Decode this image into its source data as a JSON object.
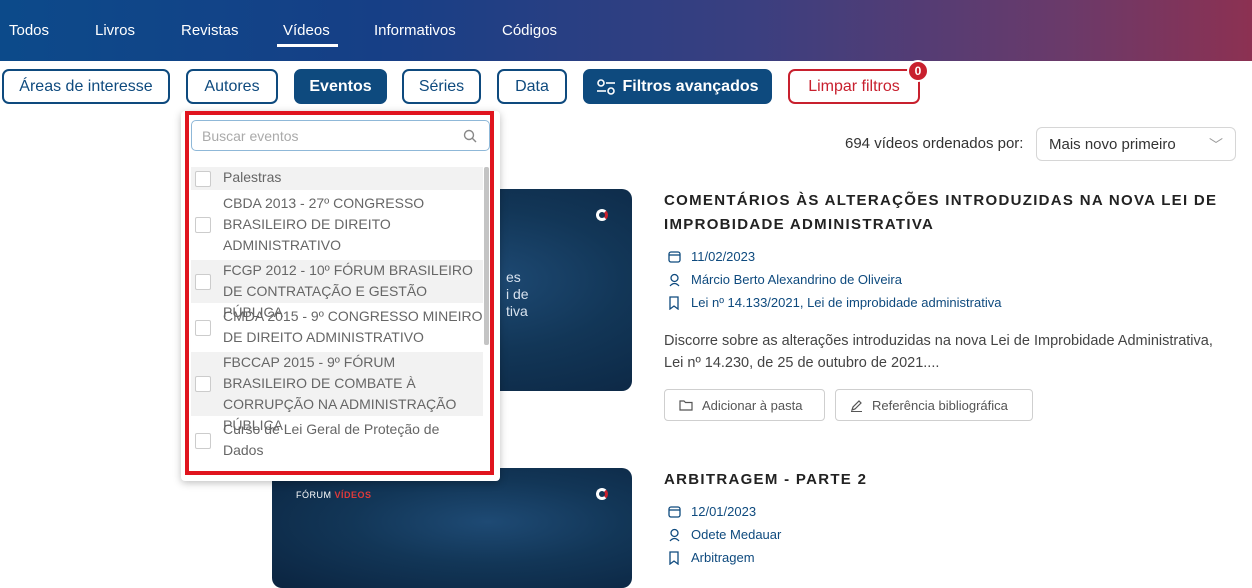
{
  "nav": {
    "tabs": [
      "Todos",
      "Livros",
      "Revistas",
      "Vídeos",
      "Informativos",
      "Códigos"
    ],
    "active": "Vídeos"
  },
  "filters": {
    "areas": "Áreas de interesse",
    "autores": "Autores",
    "eventos": "Eventos",
    "series": "Séries",
    "data": "Data",
    "avancados": "Filtros avançados",
    "limpar": "Limpar filtros",
    "badge": "0"
  },
  "results": {
    "count": "694 vídeos ordenados por:",
    "sort": "Mais novo primeiro"
  },
  "dropdown": {
    "placeholder": "Buscar eventos",
    "options": [
      "Palestras",
      "CBDA 2013 - 27º CONGRESSO BRASILEIRO DE DIREITO ADMINISTRATIVO",
      "FCGP 2012 - 10º FÓRUM BRASILEIRO DE CONTRATAÇÃO E GESTÃO PÚBLICA",
      "CMDA 2015 - 9º CONGRESSO MINEIRO DE DIREITO ADMINISTRATIVO",
      "FBCCAP 2015 - 9º FÓRUM BRASILEIRO DE COMBATE À CORRUPÇÃO NA ADMINISTRAÇÃO PÚBLICA",
      "Curso de Lei Geral de Proteção de Dados"
    ]
  },
  "videos": [
    {
      "title": "COMENTÁRIOS ÀS ALTERAÇÕES INTRODUZIDAS NA NOVA LEI DE IMPROBIDADE ADMINISTRATIVA",
      "date": "11/02/2023",
      "author": "Márcio Berto Alexandrino de Oliveira",
      "tag": "Lei nº 14.133/2021, Lei de improbidade administrativa",
      "desc": "Discorre sobre as alterações introduzidas na nova Lei de Improbidade Administrativa, Lei nº 14.230, de 25 de outubro de 2021....",
      "add": "Adicionar à pasta",
      "ref": "Referência bibliográfica",
      "thumb_text": [
        "es",
        "i de",
        "tiva"
      ]
    },
    {
      "title": "ARBITRAGEM - PARTE 2",
      "date": "12/01/2023",
      "author": "Odete Medauar",
      "tag": "Arbitragem",
      "thumb_brand": "FÓRUM",
      "thumb_brand_red": "VÍDEOS"
    }
  ],
  "colors": {
    "primary": "#0e4a7e",
    "danger": "#c8202e",
    "highlight": "#e0141e"
  }
}
